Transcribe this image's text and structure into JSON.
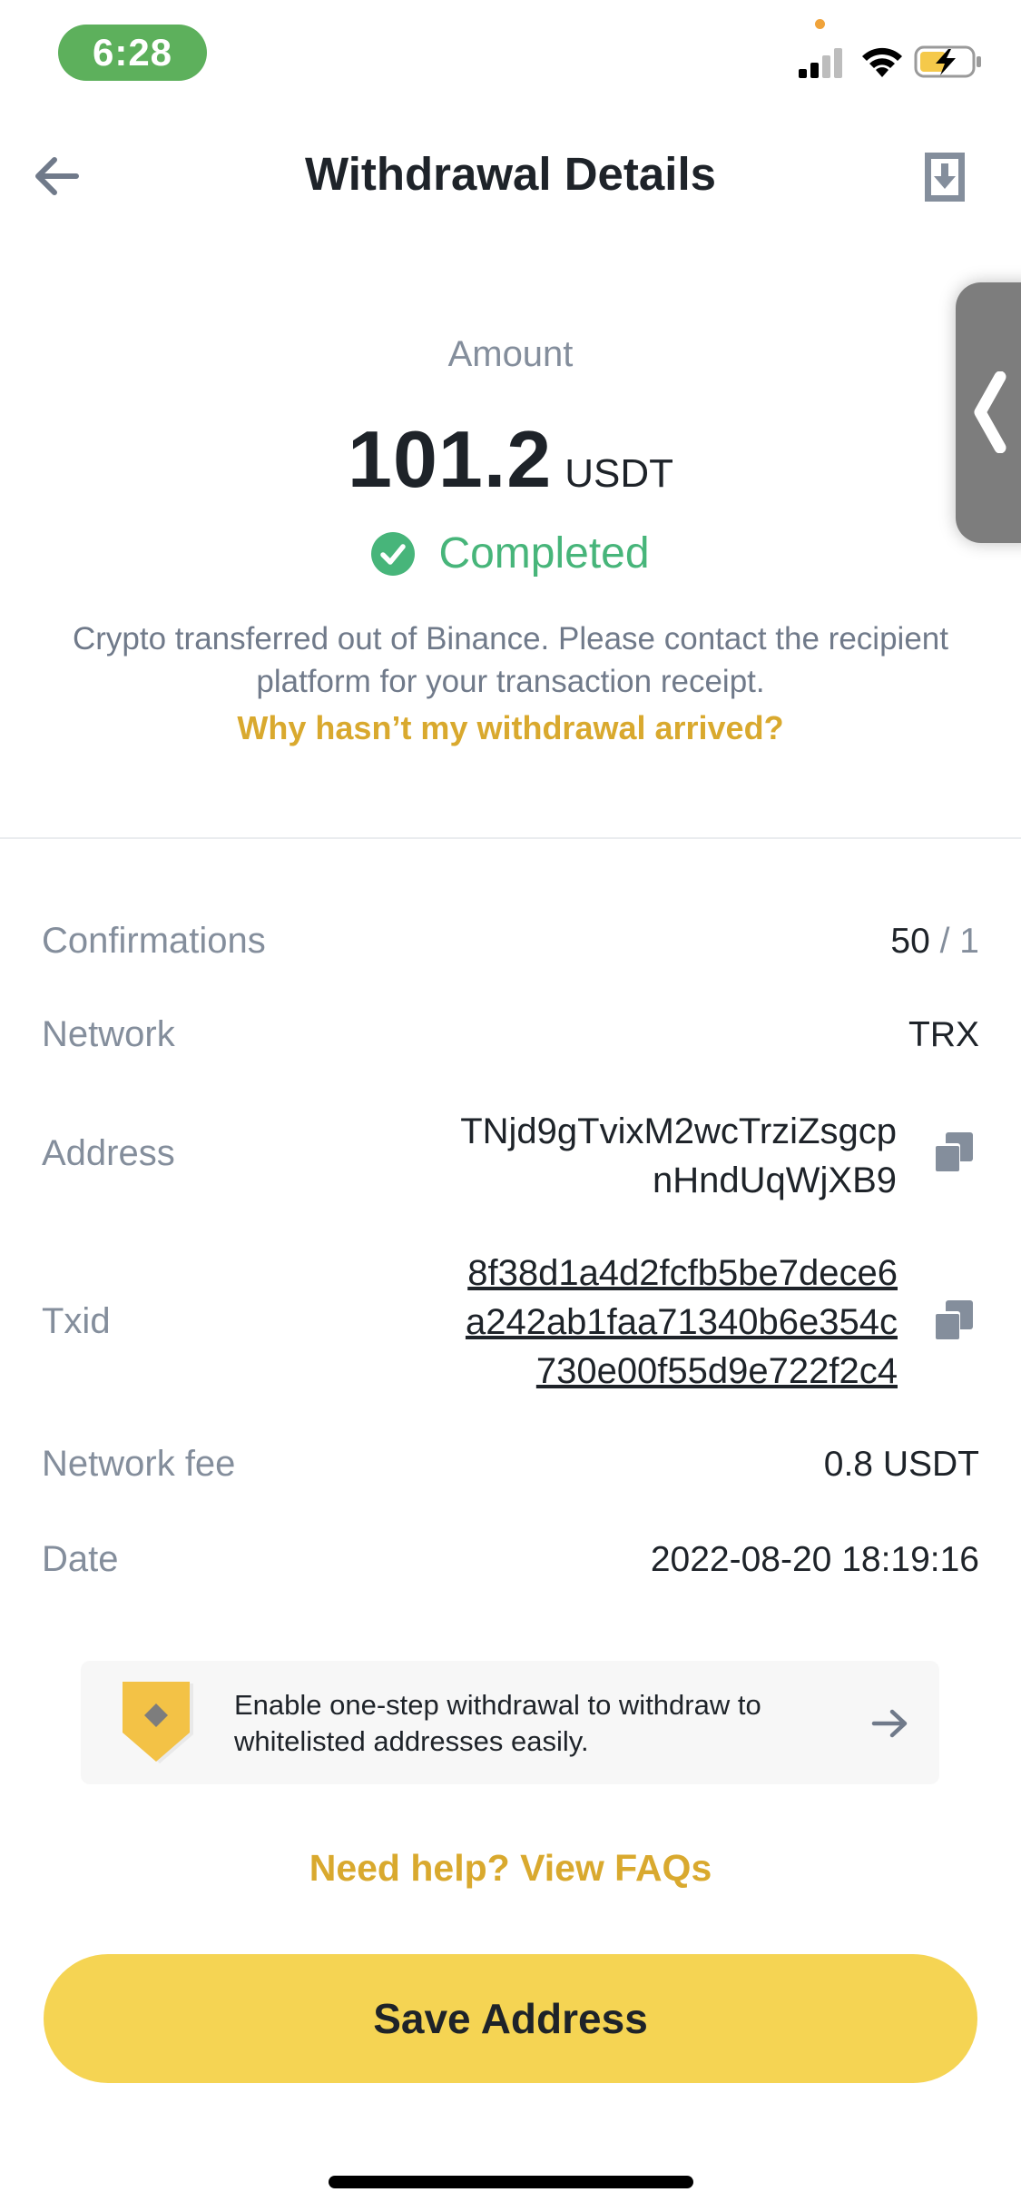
{
  "status_bar": {
    "time": "6:28"
  },
  "header": {
    "title": "Withdrawal Details"
  },
  "summary": {
    "amount_label": "Amount",
    "amount": "101.2",
    "currency": "USDT",
    "status": "Completed",
    "description_line1": "Crypto transferred out of Binance. Please contact the recipient",
    "description_line2": "platform for your transaction receipt.",
    "help_link": "Why hasn’t my withdrawal arrived?"
  },
  "details": {
    "confirmations": {
      "label": "Confirmations",
      "current": "50",
      "separator": " / ",
      "required": "1"
    },
    "network": {
      "label": "Network",
      "value": "TRX"
    },
    "address": {
      "label": "Address",
      "line1": "TNjd9gTvixM2wcTrziZsgcp",
      "line2": "nHndUqWjXB9"
    },
    "txid": {
      "label": "Txid",
      "line1": "8f38d1a4d2fcfb5be7dece6",
      "line2": "a242ab1faa71340b6e354c",
      "line3": "730e00f55d9e722f2c4"
    },
    "network_fee": {
      "label": "Network fee",
      "value": "0.8 USDT"
    },
    "date": {
      "label": "Date",
      "value": "2022-08-20 18:19:16"
    }
  },
  "banner": {
    "line1": "Enable one-step withdrawal to withdraw to",
    "line2": "whitelisted addresses easily."
  },
  "faq_link": "Need help? View FAQs",
  "save_button": "Save Address",
  "colors": {
    "accent": "#F5D453",
    "link": "#D9A92E",
    "success": "#47B57A",
    "muted": "#848E9C"
  }
}
